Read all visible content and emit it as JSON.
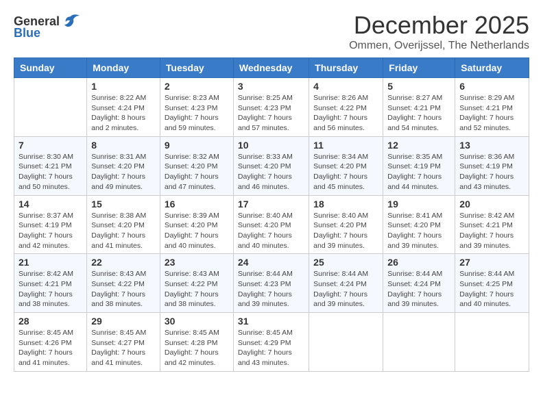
{
  "logo": {
    "general": "General",
    "blue": "Blue"
  },
  "title": "December 2025",
  "subtitle": "Ommen, Overijssel, The Netherlands",
  "days_of_week": [
    "Sunday",
    "Monday",
    "Tuesday",
    "Wednesday",
    "Thursday",
    "Friday",
    "Saturday"
  ],
  "weeks": [
    [
      {
        "day": "",
        "info": ""
      },
      {
        "day": "1",
        "info": "Sunrise: 8:22 AM\nSunset: 4:24 PM\nDaylight: 8 hours\nand 2 minutes."
      },
      {
        "day": "2",
        "info": "Sunrise: 8:23 AM\nSunset: 4:23 PM\nDaylight: 7 hours\nand 59 minutes."
      },
      {
        "day": "3",
        "info": "Sunrise: 8:25 AM\nSunset: 4:23 PM\nDaylight: 7 hours\nand 57 minutes."
      },
      {
        "day": "4",
        "info": "Sunrise: 8:26 AM\nSunset: 4:22 PM\nDaylight: 7 hours\nand 56 minutes."
      },
      {
        "day": "5",
        "info": "Sunrise: 8:27 AM\nSunset: 4:21 PM\nDaylight: 7 hours\nand 54 minutes."
      },
      {
        "day": "6",
        "info": "Sunrise: 8:29 AM\nSunset: 4:21 PM\nDaylight: 7 hours\nand 52 minutes."
      }
    ],
    [
      {
        "day": "7",
        "info": "Sunrise: 8:30 AM\nSunset: 4:21 PM\nDaylight: 7 hours\nand 50 minutes."
      },
      {
        "day": "8",
        "info": "Sunrise: 8:31 AM\nSunset: 4:20 PM\nDaylight: 7 hours\nand 49 minutes."
      },
      {
        "day": "9",
        "info": "Sunrise: 8:32 AM\nSunset: 4:20 PM\nDaylight: 7 hours\nand 47 minutes."
      },
      {
        "day": "10",
        "info": "Sunrise: 8:33 AM\nSunset: 4:20 PM\nDaylight: 7 hours\nand 46 minutes."
      },
      {
        "day": "11",
        "info": "Sunrise: 8:34 AM\nSunset: 4:20 PM\nDaylight: 7 hours\nand 45 minutes."
      },
      {
        "day": "12",
        "info": "Sunrise: 8:35 AM\nSunset: 4:19 PM\nDaylight: 7 hours\nand 44 minutes."
      },
      {
        "day": "13",
        "info": "Sunrise: 8:36 AM\nSunset: 4:19 PM\nDaylight: 7 hours\nand 43 minutes."
      }
    ],
    [
      {
        "day": "14",
        "info": "Sunrise: 8:37 AM\nSunset: 4:19 PM\nDaylight: 7 hours\nand 42 minutes."
      },
      {
        "day": "15",
        "info": "Sunrise: 8:38 AM\nSunset: 4:20 PM\nDaylight: 7 hours\nand 41 minutes."
      },
      {
        "day": "16",
        "info": "Sunrise: 8:39 AM\nSunset: 4:20 PM\nDaylight: 7 hours\nand 40 minutes."
      },
      {
        "day": "17",
        "info": "Sunrise: 8:40 AM\nSunset: 4:20 PM\nDaylight: 7 hours\nand 40 minutes."
      },
      {
        "day": "18",
        "info": "Sunrise: 8:40 AM\nSunset: 4:20 PM\nDaylight: 7 hours\nand 39 minutes."
      },
      {
        "day": "19",
        "info": "Sunrise: 8:41 AM\nSunset: 4:20 PM\nDaylight: 7 hours\nand 39 minutes."
      },
      {
        "day": "20",
        "info": "Sunrise: 8:42 AM\nSunset: 4:21 PM\nDaylight: 7 hours\nand 39 minutes."
      }
    ],
    [
      {
        "day": "21",
        "info": "Sunrise: 8:42 AM\nSunset: 4:21 PM\nDaylight: 7 hours\nand 38 minutes."
      },
      {
        "day": "22",
        "info": "Sunrise: 8:43 AM\nSunset: 4:22 PM\nDaylight: 7 hours\nand 38 minutes."
      },
      {
        "day": "23",
        "info": "Sunrise: 8:43 AM\nSunset: 4:22 PM\nDaylight: 7 hours\nand 38 minutes."
      },
      {
        "day": "24",
        "info": "Sunrise: 8:44 AM\nSunset: 4:23 PM\nDaylight: 7 hours\nand 39 minutes."
      },
      {
        "day": "25",
        "info": "Sunrise: 8:44 AM\nSunset: 4:24 PM\nDaylight: 7 hours\nand 39 minutes."
      },
      {
        "day": "26",
        "info": "Sunrise: 8:44 AM\nSunset: 4:24 PM\nDaylight: 7 hours\nand 39 minutes."
      },
      {
        "day": "27",
        "info": "Sunrise: 8:44 AM\nSunset: 4:25 PM\nDaylight: 7 hours\nand 40 minutes."
      }
    ],
    [
      {
        "day": "28",
        "info": "Sunrise: 8:45 AM\nSunset: 4:26 PM\nDaylight: 7 hours\nand 41 minutes."
      },
      {
        "day": "29",
        "info": "Sunrise: 8:45 AM\nSunset: 4:27 PM\nDaylight: 7 hours\nand 41 minutes."
      },
      {
        "day": "30",
        "info": "Sunrise: 8:45 AM\nSunset: 4:28 PM\nDaylight: 7 hours\nand 42 minutes."
      },
      {
        "day": "31",
        "info": "Sunrise: 8:45 AM\nSunset: 4:29 PM\nDaylight: 7 hours\nand 43 minutes."
      },
      {
        "day": "",
        "info": ""
      },
      {
        "day": "",
        "info": ""
      },
      {
        "day": "",
        "info": ""
      }
    ]
  ]
}
